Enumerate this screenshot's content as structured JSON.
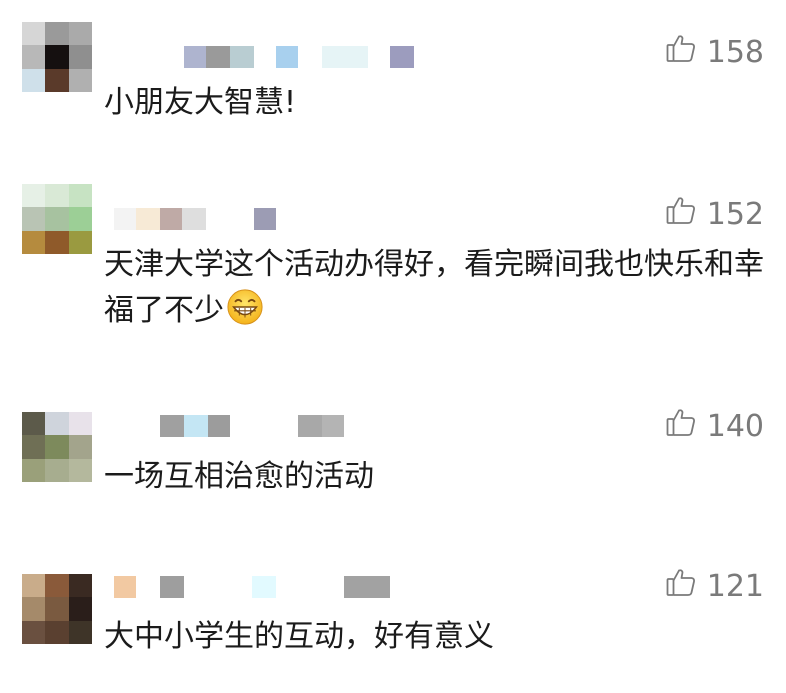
{
  "comments": [
    {
      "likes": "158",
      "text": "小朋友大智慧!",
      "avatar_colors": [
        "#d6d6d6",
        "#9a9a9a",
        "#aaaaaa",
        "#b8b8b8",
        "#151010",
        "#8f8f8f",
        "#cfe0ea",
        "#5a3a2a",
        "#b0b0b0"
      ],
      "username_blocks": [
        {
          "color": "#aeb4cf"
        },
        {
          "color": "#9a9a9a"
        },
        {
          "color": "#b9cdd2"
        },
        {
          "color": "#a8d0ee"
        },
        {
          "color": "#e6f4f6"
        },
        {
          "color": "#9c9cbe"
        }
      ]
    },
    {
      "likes": "152",
      "text": "天津大学这个活动办得好，看完瞬间我也快乐和幸福了不少",
      "avatar_colors": [
        "#e6f0e6",
        "#d9e9d6",
        "#c7e3c3",
        "#b9c4b4",
        "#a7c2a0",
        "#9ccf96",
        "#b58b3e",
        "#8f5a2a",
        "#9a9a40"
      ],
      "username_blocks": [
        {
          "color": "#f3f3f3"
        },
        {
          "color": "#f7ead6"
        },
        {
          "color": "#bfaaa6"
        },
        {
          "color": "#dedede"
        },
        {
          "color": "#9c9cb4"
        }
      ]
    },
    {
      "likes": "140",
      "text": "一场互相治愈的活动",
      "avatar_colors": [
        "#5c5a4a",
        "#cfd4dc",
        "#e8e2ea",
        "#6f6f55",
        "#7d8a5c",
        "#a3a48c",
        "#9aa07a",
        "#a7ad8f",
        "#b4b89d"
      ],
      "username_blocks": [
        {
          "color": "#a0a0a0"
        },
        {
          "color": "#c4e6f4"
        },
        {
          "color": "#9c9c9c"
        },
        {
          "color": "#a8a8a8"
        },
        {
          "color": "#b4b4b4"
        }
      ]
    },
    {
      "likes": "121",
      "text": "大中小学生的互动，好有意义",
      "avatar_colors": [
        "#c9ac8a",
        "#8a5a3a",
        "#3a2a22",
        "#a58a6a",
        "#7a5a40",
        "#2a1e1a",
        "#6a5040",
        "#5a4030",
        "#3e3428"
      ],
      "username_blocks": [
        {
          "color": "#f2c9a2"
        },
        {
          "color": "#9e9e9e"
        },
        {
          "color": "#e2faff"
        },
        {
          "color": "#a2a2a2"
        }
      ]
    }
  ],
  "icons": {
    "like": "thumbs-up-outline-icon",
    "emoji": "grinning-face-icon"
  }
}
